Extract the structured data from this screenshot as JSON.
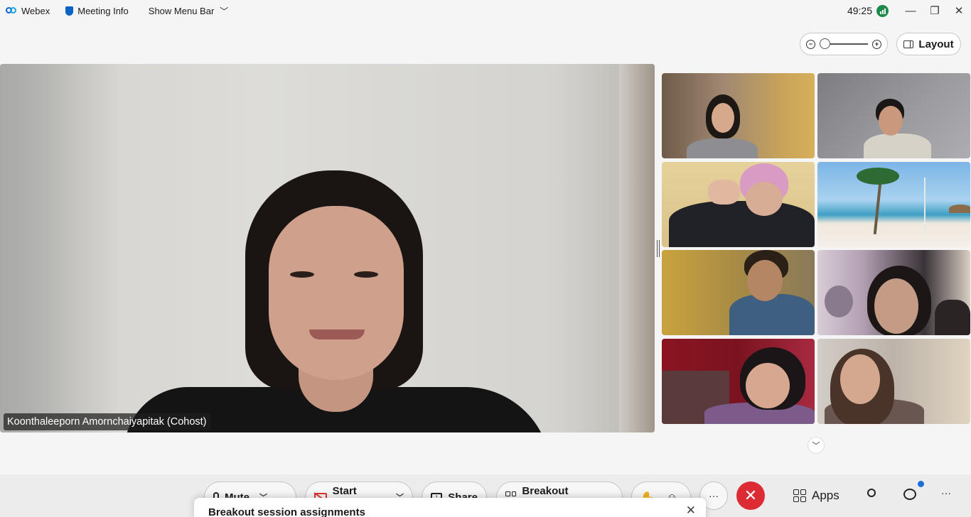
{
  "titlebar": {
    "app_name": "Webex",
    "meeting_info": "Meeting Info",
    "show_menu_bar": "Show Menu Bar",
    "timer": "49:25",
    "minimize": "—",
    "restore": "❐",
    "close": "✕"
  },
  "view": {
    "layout_label": "Layout"
  },
  "main_video": {
    "speaker_name": "Koonthaleeporn Amornchaiyapitak (Cohost)"
  },
  "controls": {
    "mute_label": "Mute",
    "start_video_label": "Start video",
    "share_label": "Share",
    "breakout_label": "Breakout sessions",
    "more_label": "···",
    "end_label": "✕",
    "apps_label": "Apps",
    "overflow_label": "···"
  },
  "popup": {
    "title": "Breakout session assignments",
    "close": "✕"
  },
  "colors": {
    "end_call": "#dc2b33",
    "notification": "#1c6fd6",
    "audio_indicator": "#1d8a4a"
  }
}
